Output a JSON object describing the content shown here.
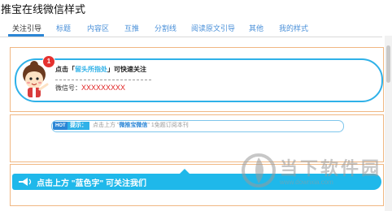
{
  "app": {
    "title": "推宝在线微信样式"
  },
  "tabs": [
    {
      "label": "关注引导",
      "active": true
    },
    {
      "label": "标题"
    },
    {
      "label": "内容区"
    },
    {
      "label": "互推"
    },
    {
      "label": "分割线"
    },
    {
      "label": "阅读原文引导"
    },
    {
      "label": "其他"
    },
    {
      "label": "我的样式"
    }
  ],
  "cards": {
    "card1": {
      "prefix": "点击「",
      "highlight": "留头所指处",
      "suffix": "」可快速关注",
      "wechat_label": "微信号：",
      "wechat_value": "XXXXXXXXX",
      "badge": "1"
    },
    "card2": {
      "hot": "HOT",
      "tip": "提示：",
      "text_before": "点击上方 \"",
      "highlight": "微推宝微信",
      "text_after": "\" 1免题订阅本刊"
    },
    "card3": {
      "text": "点击上方 \"蓝色字\" 可关注我们"
    }
  },
  "watermark": {
    "title": "当下软件园",
    "sub": "www.downxia.com"
  },
  "colors": {
    "accent": "#2fb1e8",
    "tab_link": "#4a90d9",
    "panel_border": "#f0b782",
    "badge": "#e5312f",
    "wechat_id": "#e02020"
  }
}
